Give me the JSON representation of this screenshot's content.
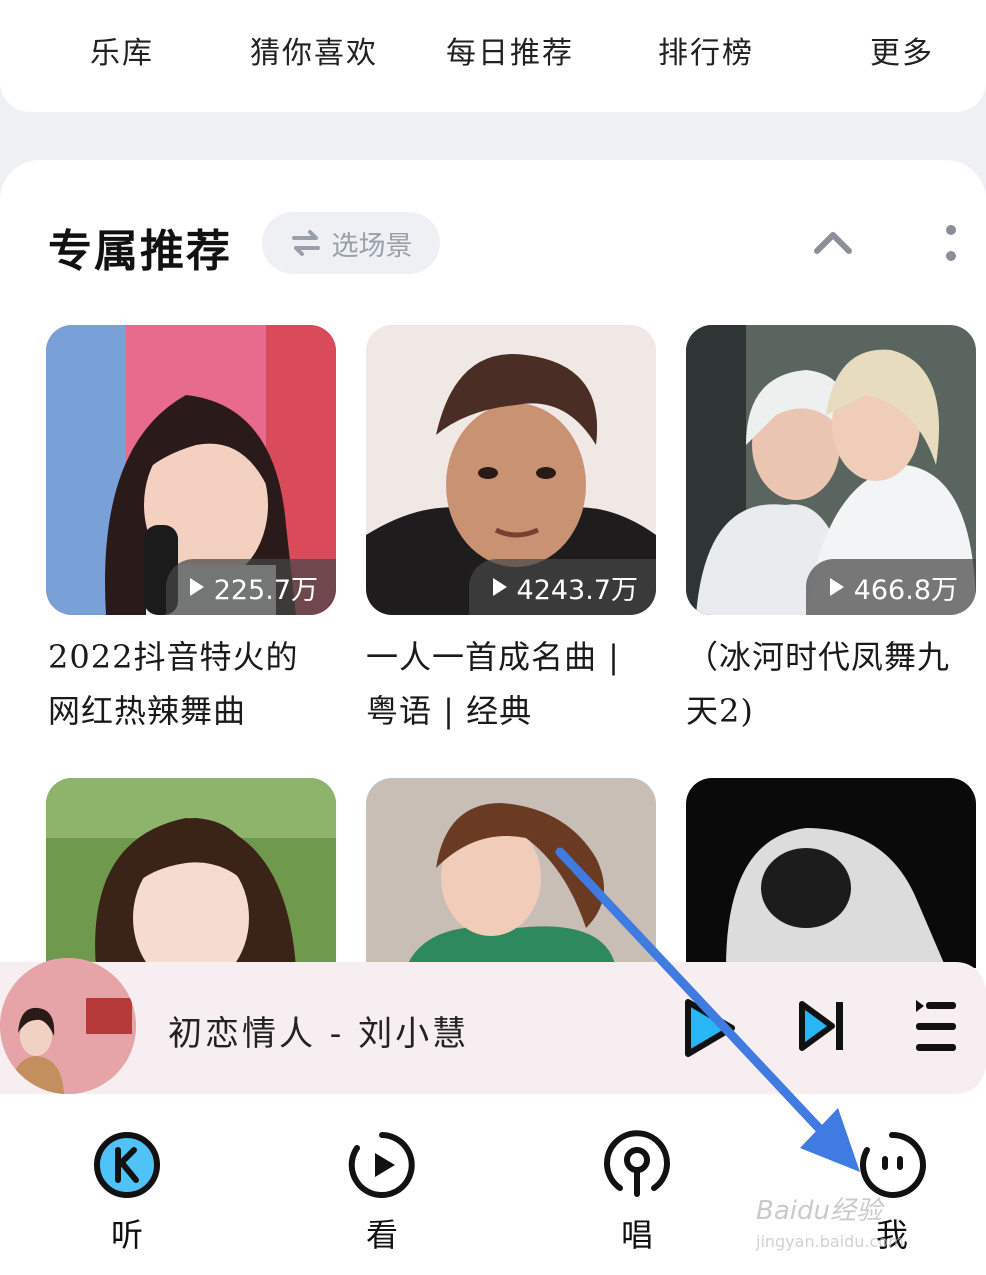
{
  "top_nav": [
    "乐库",
    "猜你喜欢",
    "每日推荐",
    "排行榜",
    "更多"
  ],
  "section": {
    "title": "专属推荐",
    "scene_label": "选场景"
  },
  "playlists": [
    {
      "plays": "225.7万",
      "title_line1": "2022抖音特火的",
      "title_line2": "网红热辣舞曲"
    },
    {
      "plays": "4243.7万",
      "title_line1": "一人一首成名曲 |",
      "title_line2": "粤语 | 经典"
    },
    {
      "plays": "466.8万",
      "title_line1": "（冰河时代凤舞九",
      "title_line2": "天2)"
    }
  ],
  "player": {
    "song": "初恋情人  -  刘小慧"
  },
  "bottom_nav": [
    "听",
    "看",
    "唱",
    "我"
  ],
  "watermark": {
    "line1": "Baidu经验",
    "line2": "jingyan.baidu.com"
  },
  "colors": {
    "accent_arrow": "#3f7be0",
    "player_bg": "#f7eef1"
  }
}
